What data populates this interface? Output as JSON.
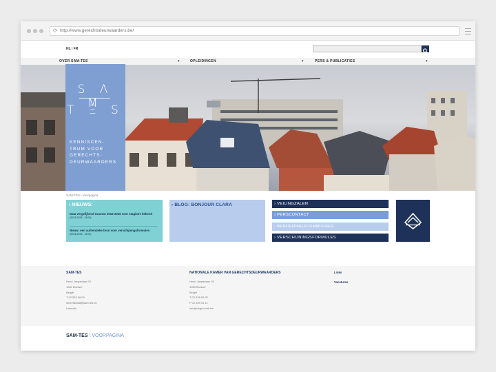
{
  "browser": {
    "url": "http://www.gerechtsdeurwaarders.be/"
  },
  "header": {
    "lang_nl": "NL",
    "lang_sep": " | ",
    "lang_fr": "FR"
  },
  "nav": {
    "items": [
      {
        "label": "OVER SAM-TES"
      },
      {
        "label": "OPLEIDINGEN"
      },
      {
        "label": "PERS & PUBLICATIES"
      }
    ]
  },
  "logo": {
    "top": "S Λ M",
    "bottom": "T Ξ S",
    "tagline": [
      "KENNISCEN-",
      "TRUM VOOR",
      "GERECHTS-",
      "DEURWAARDERS"
    ]
  },
  "breadcrumb": "SAM-TES \\ Voorpagina",
  "news": {
    "heading": "› NIEUWS:",
    "items": [
      {
        "text": "Data vergelijkend examen 2015-2016 voor stagiairs bekend",
        "date": "(20/11/2015 - 15:00)"
      },
      {
        "text": "Nieuw: een authentieke bron voor verschijningsformules",
        "date": "(02/11/2015 - 15:00)"
      }
    ]
  },
  "blog": {
    "heading": "› BLOG: BONJOUR CLARA"
  },
  "quicklinks": [
    {
      "label": "› VEILINGZALEN",
      "color": "#1e3159"
    },
    {
      "label": "› PERSCONTACT",
      "color": "#7a9dd8"
    },
    {
      "label": "› BENOEMINGSCOMMISSIES",
      "color": "#b8cdee"
    },
    {
      "label": "› VERSCHIJNINGSFORMULES",
      "color": "#1e3159"
    }
  ],
  "footer": {
    "col1": {
      "title": "SAM-TES",
      "lines": [
        "Henri Jasparlaan 93",
        "1060 Brussel",
        "België",
        "T 02 533 98 00",
        "secretariaat@sam-tes.be",
        "LinkedIn"
      ]
    },
    "col2": {
      "title": "NATIONALE KAMER VAN GERECHTSDEURWAARDERS",
      "lines": [
        "Henri Jasparlaan 93",
        "1060 Brussel",
        "België",
        "T 02 538 00 92",
        "F 02 539 41 11",
        "info@nkgd-cnhb.be"
      ]
    },
    "col3": {
      "links": [
        "Links",
        "Vacatures"
      ]
    },
    "bottom": {
      "site": "SAM-TES",
      "sep": " \\ ",
      "page": "VOORPAGINA"
    }
  },
  "colors": {
    "navy": "#1e3159",
    "periwinkle": "#7f9fd3",
    "teal": "#7fd1d4",
    "light_blue": "#b8cdee"
  }
}
